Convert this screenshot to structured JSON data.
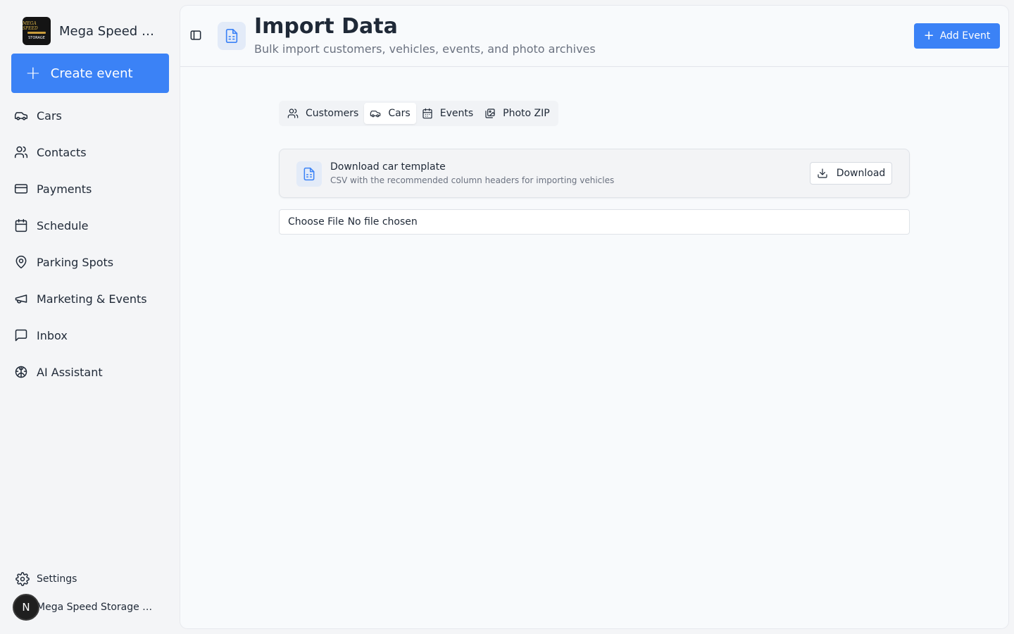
{
  "sidebar": {
    "brand_name": "Mega Speed Storage",
    "logo_text_top": "MEGA SPEED",
    "logo_text_bottom": "STORAGE",
    "create_label": "Create event",
    "items": [
      {
        "label": "Cars",
        "icon": "car-icon"
      },
      {
        "label": "Contacts",
        "icon": "users-icon"
      },
      {
        "label": "Payments",
        "icon": "credit-card-icon"
      },
      {
        "label": "Schedule",
        "icon": "calendar-icon"
      },
      {
        "label": "Parking Spots",
        "icon": "map-pin-icon"
      },
      {
        "label": "Marketing & Events",
        "icon": "megaphone-icon"
      },
      {
        "label": "Inbox",
        "icon": "message-square-icon"
      },
      {
        "label": "AI Assistant",
        "icon": "brain-icon"
      }
    ],
    "settings_label": "Settings",
    "user_initial": "N",
    "user_name": "Mega Speed Storage Admin"
  },
  "header": {
    "title": "Import Data",
    "subtitle": "Bulk import customers, vehicles, events, and photo archives",
    "add_event_label": "Add Event"
  },
  "tabs": [
    {
      "label": "Customers",
      "icon": "users-icon",
      "active": false
    },
    {
      "label": "Cars",
      "icon": "car-icon",
      "active": true
    },
    {
      "label": "Events",
      "icon": "calendar-icon",
      "active": false
    },
    {
      "label": "Photo ZIP",
      "icon": "images-icon",
      "active": false
    }
  ],
  "template_card": {
    "title": "Download car template",
    "description": "CSV with the recommended column headers for importing vehicles",
    "download_label": "Download"
  },
  "file_input": {
    "button_label": "Choose File",
    "status": "No file chosen"
  },
  "colors": {
    "accent": "#3b82f6",
    "icon_bg": "#e3ebf8"
  }
}
